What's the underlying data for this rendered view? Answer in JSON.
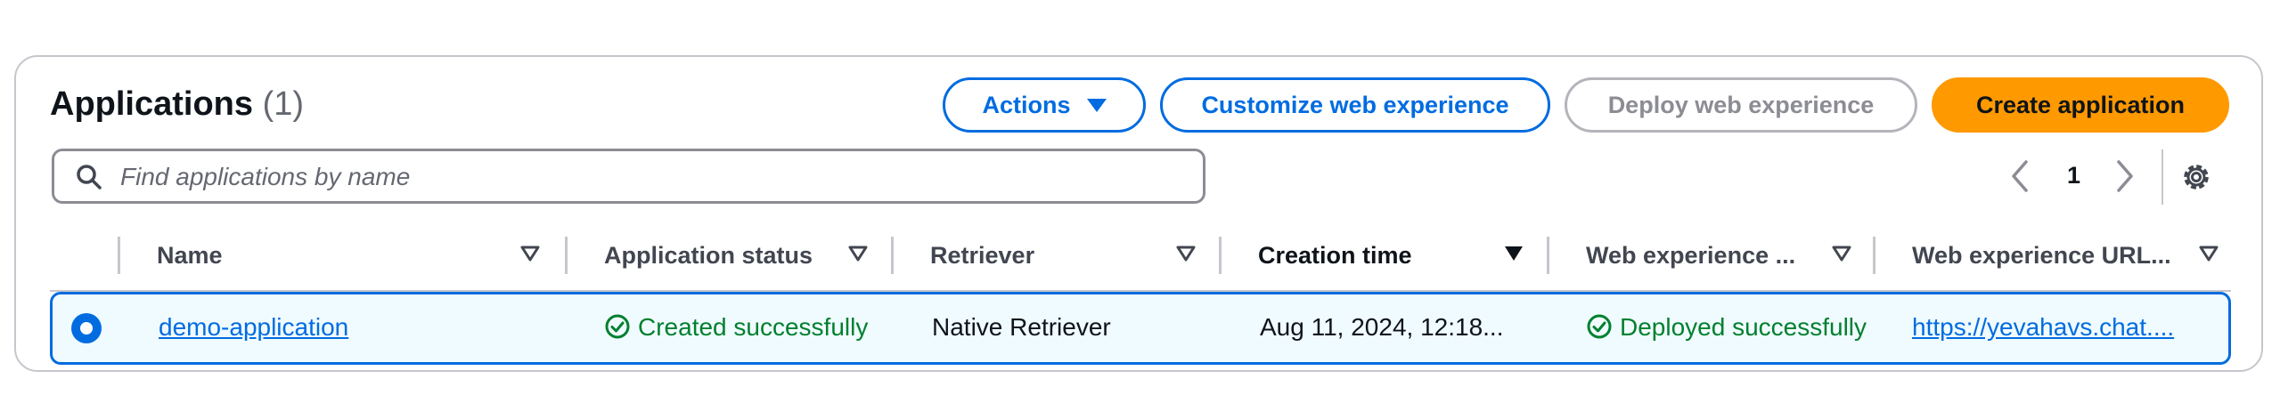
{
  "header": {
    "title": "Applications",
    "count": "(1)"
  },
  "actions": {
    "actions_label": "Actions",
    "customize_label": "Customize web experience",
    "deploy_label": "Deploy web experience",
    "create_label": "Create application"
  },
  "search": {
    "placeholder": "Find applications by name"
  },
  "pagination": {
    "current_page": "1"
  },
  "table": {
    "columns": [
      "Name",
      "Application status",
      "Retriever",
      "Creation time",
      "Web experience ...",
      "Web experience URL..."
    ],
    "rows": [
      {
        "name": "demo-application",
        "application_status": "Created successfully",
        "retriever": "Native Retriever",
        "creation_time": "Aug 11, 2024, 12:18...",
        "web_experience_status": "Deployed successfully",
        "web_experience_url": "https://yevahavs.chat...."
      }
    ]
  },
  "colors": {
    "link_blue": "#006ce0",
    "primary_orange": "#ff9900",
    "success_green": "#00802f",
    "selected_row_bg": "#f0fbff"
  },
  "icons": [
    "search-icon",
    "chevron-left-icon",
    "chevron-right-icon",
    "settings-gear-icon",
    "caret-down-icon",
    "sort-icon",
    "check-circle-icon"
  ]
}
